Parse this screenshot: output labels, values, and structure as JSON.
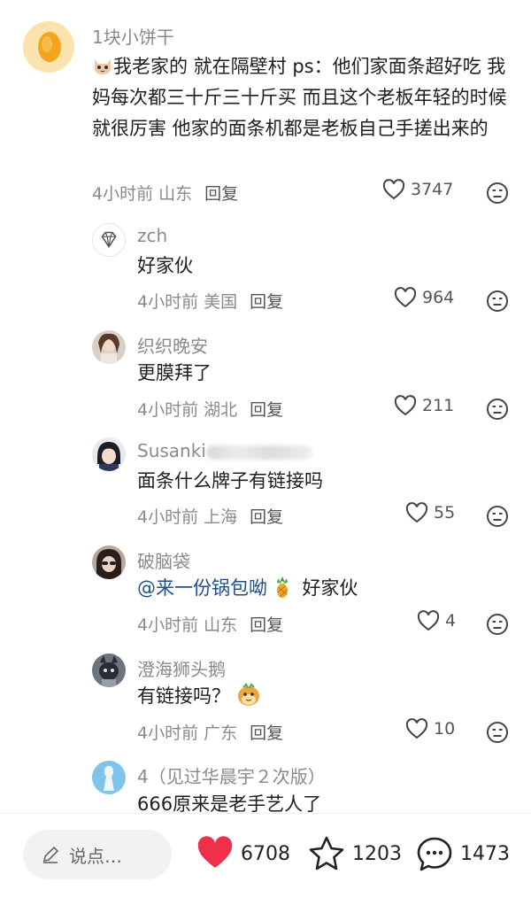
{
  "comments": [
    {
      "username": "1块小饼干",
      "text": "我老家的 就在隔壁村 ps：他们家面条超好吃 我妈每次都三十斤三十斤买 而且这个老板年轻的时候就很厉害 他家的面条机都是老板自己手搓出来的",
      "time": "4小时前",
      "location": "山东",
      "reply": "回复",
      "likes": "3747"
    },
    {
      "username": "zch",
      "text": "好家伙",
      "time": "4小时前",
      "location": "美国",
      "reply": "回复",
      "likes": "964"
    },
    {
      "username": "织织晚安",
      "text": "更膜拜了",
      "time": "4小时前",
      "location": "湖北",
      "reply": "回复",
      "likes": "211"
    },
    {
      "username": "Susanki",
      "text": "面条什么牌子有链接吗",
      "time": "4小时前",
      "location": "上海",
      "reply": "回复",
      "likes": "55"
    },
    {
      "username": "破脑袋",
      "mention": "@来一份锅包呦",
      "text": "好家伙",
      "time": "4小时前",
      "location": "山东",
      "reply": "回复",
      "likes": "4"
    },
    {
      "username": "澄海狮头鹅",
      "text": "有链接吗？",
      "time": "4小时前",
      "location": "广东",
      "reply": "回复",
      "likes": "10"
    },
    {
      "username": "4（见过华晨宇２次版）",
      "text": "666原来是老手艺人了"
    }
  ],
  "bottom_bar": {
    "input_placeholder": "说点…",
    "likes": "6708",
    "favorites": "1203",
    "comments": "1473"
  },
  "colors": {
    "like_red": "#f0304a",
    "meta_gray": "#8a8a8a",
    "mention_blue": "#1f4e8a"
  }
}
